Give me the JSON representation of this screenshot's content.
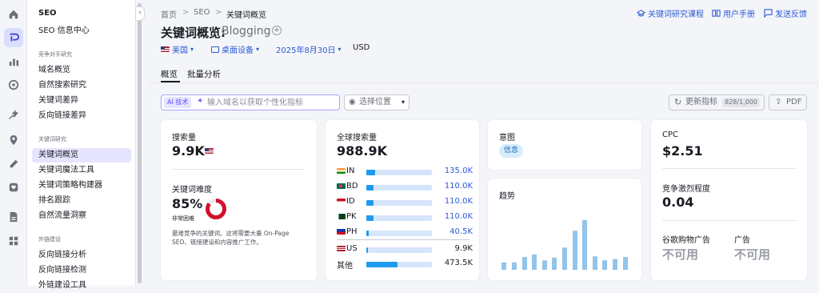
{
  "sidebar": {
    "header": "SEO",
    "top_item": "SEO 信息中心",
    "section1_title": "竞争对手研究",
    "section1_items": [
      "域名概览",
      "自然搜索研究",
      "关键词差异",
      "反向链接差异"
    ],
    "section2_title": "关键词研究",
    "section2_items": [
      "关键词概览",
      "关键词魔法工具",
      "关键词策略构建器",
      "排名跟踪",
      "自然流量洞察"
    ],
    "section3_title": "外链建设",
    "section3_items": [
      "反向链接分析",
      "反向链接检测",
      "外链建设工具"
    ],
    "rail_icons": [
      "home-icon",
      "semrush-logo-icon",
      "bar-chart-icon",
      "target-icon",
      "sparkle-growth-icon",
      "location-pin-icon",
      "pencil-icon",
      "shield-heart-icon",
      "document-icon",
      "grid-apps-icon"
    ]
  },
  "breadcrumb": {
    "home": "首页",
    "seo": "SEO",
    "current": "关键词概览",
    "sep": ">"
  },
  "top_links": {
    "course": "关键词研究课程",
    "manual": "用户手册",
    "feedback": "发送反馈"
  },
  "page": {
    "title": "关键词概览:",
    "keyword": "Blogging",
    "add_symbol": "+"
  },
  "filters": {
    "country": "美国",
    "device": "桌面设备",
    "date": "2025年8月30日",
    "currency": "USD"
  },
  "tabs": {
    "overview": "概览",
    "bulk": "批量分析"
  },
  "ai_search": {
    "tag": "AI 技术",
    "placeholder": "输入域名以获取个性化指标"
  },
  "location_select": "选择位置",
  "update_button": {
    "label": "更新指标",
    "count": "828/1,000"
  },
  "pdf_button": "PDF",
  "volume_card": {
    "label": "搜索量",
    "value": "9.9K",
    "difficulty_label": "关键词难度",
    "difficulty_value": "85%",
    "difficulty_fraction": 0.85,
    "difficulty_text": "非常困难",
    "description": "最难竞争的关键词。这将需要大量 On-Page SEO、链接建设和内容推广工作。"
  },
  "global_card": {
    "label": "全球搜索量",
    "value": "988.9K",
    "countries": [
      {
        "code": "IN",
        "value": "135.0K",
        "fraction": 0.137
      },
      {
        "code": "BD",
        "value": "110.0K",
        "fraction": 0.111
      },
      {
        "code": "ID",
        "value": "110.0K",
        "fraction": 0.111
      },
      {
        "code": "PK",
        "value": "110.0K",
        "fraction": 0.111
      },
      {
        "code": "PH",
        "value": "40.5K",
        "fraction": 0.041
      }
    ],
    "us": {
      "code": "US",
      "value": "9.9K",
      "fraction": 0.01
    },
    "other": {
      "label": "其他",
      "value": "473.5K",
      "fraction": 0.479
    }
  },
  "intent_card": {
    "label": "意图",
    "badge": "信息"
  },
  "trend_card": {
    "label": "趋势",
    "values": [
      0.11,
      0.11,
      0.19,
      0.23,
      0.14,
      0.18,
      0.33,
      0.58,
      0.74,
      0.2,
      0.14,
      0.16,
      0.19
    ]
  },
  "cpc_card": {
    "label": "CPC",
    "value": "$2.51",
    "comp_label": "竞争激烈程度",
    "comp_value": "0.04",
    "shopping_label": "谷歌购物广告",
    "shopping_value": "不可用",
    "ads_label": "广告",
    "ads_value": "不可用"
  },
  "colors": {
    "accent": "#2b5bd7",
    "bar": "#1e9bf0",
    "difficulty": "#d1102e",
    "trend": "#93c4ea"
  }
}
